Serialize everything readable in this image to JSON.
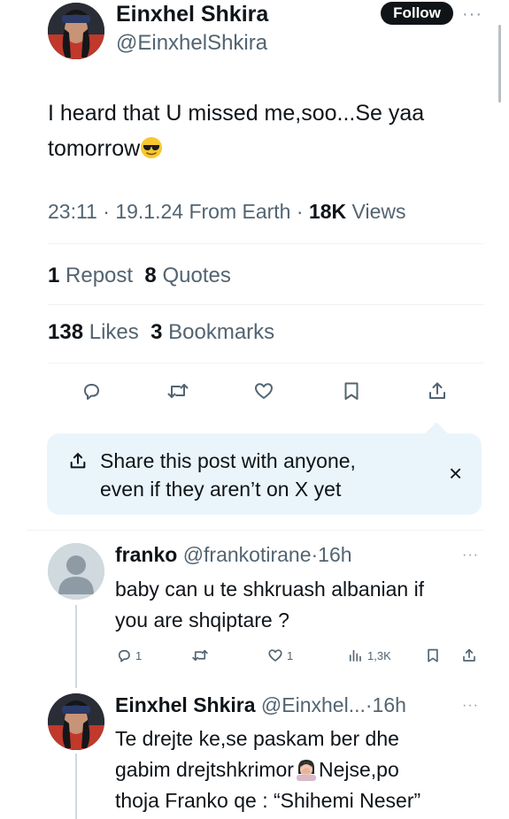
{
  "post": {
    "author_name": "Einxhel Shkira",
    "author_handle": "@EinxhelShkira",
    "follow_label": "Follow",
    "more_label": "···",
    "text_line1": "I heard that U missed me,soo...Se yaa",
    "text_line2": "tomorrow",
    "emoji": "sunglasses-emoji",
    "time": "23:11",
    "sep1": "·",
    "date": "19.1.24",
    "location": "From Earth",
    "sep2": "·",
    "views_count": "18K",
    "views_label": "Views"
  },
  "stats": {
    "reposts_count": "1",
    "reposts_label": "Repost",
    "quotes_count": "8",
    "quotes_label": "Quotes",
    "likes_count": "138",
    "likes_label": "Likes",
    "bookmarks_count": "3",
    "bookmarks_label": "Bookmarks"
  },
  "actions": [
    "reply-icon",
    "repost-icon",
    "like-icon",
    "bookmark-icon",
    "share-icon"
  ],
  "share_prompt": {
    "line1": "Share this post with anyone,",
    "line2": "even if they aren’t on X yet",
    "close": "×"
  },
  "replies": [
    {
      "name": "franko",
      "handle": "@frankotirane",
      "time": "·16h",
      "more": "···",
      "line1": "baby can u te shkruash albanian if",
      "line2": "you are shqiptare ?",
      "reply_count": "1",
      "like_count": "1",
      "views": "1,3K"
    },
    {
      "name": "Einxhel Shkira",
      "handle": "@Einxhel...",
      "time": "·16h",
      "more": "···",
      "line1": "Te drejte ke,se paskam ber dhe",
      "line2a": "gabim drejtshkrimor",
      "line2b": "Nejse,po",
      "line3": "thoja Franko qe : “Shihemi Neser”"
    }
  ],
  "colors": {
    "text": "#0f1419",
    "muted": "#536471",
    "share_bg": "#eaf5fb",
    "divider": "#eff3f4"
  }
}
